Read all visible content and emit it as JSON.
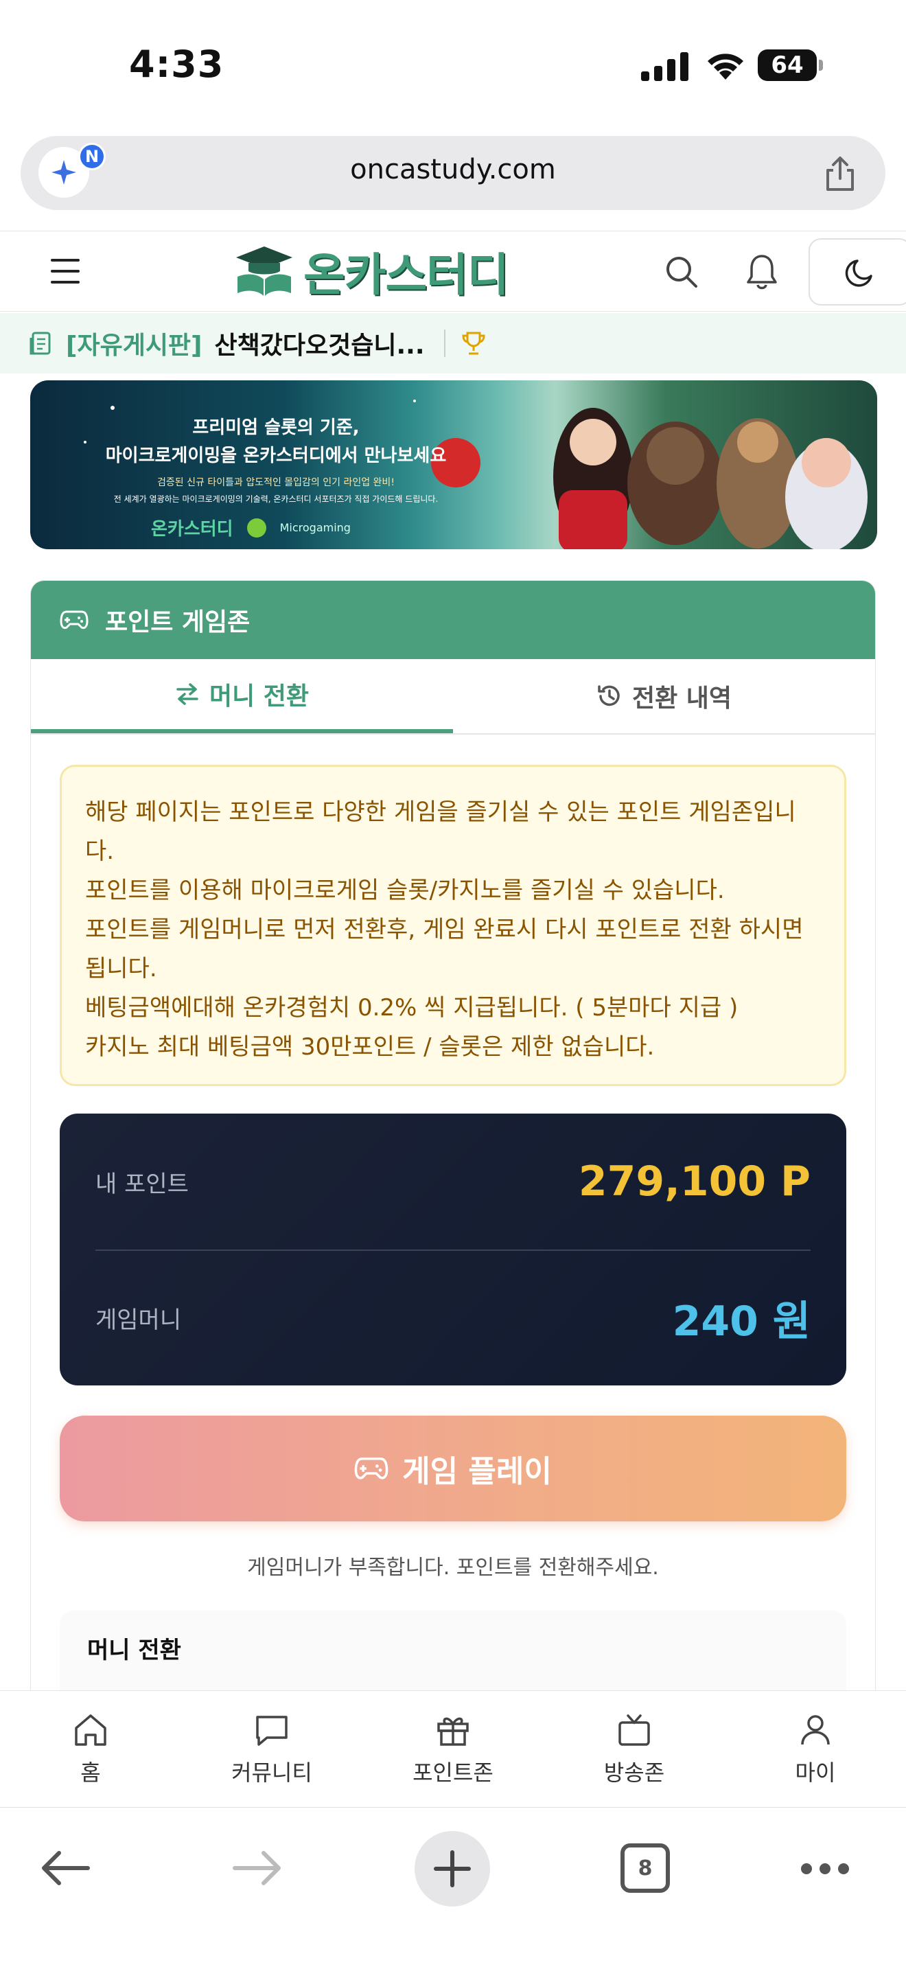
{
  "status_bar": {
    "time": "4:33",
    "battery": "64"
  },
  "browser": {
    "url": "oncastudy.com",
    "ai_badge": "N",
    "tab_count": "8"
  },
  "site": {
    "logo_text": "온카스터디"
  },
  "notice": {
    "board": "[자유게시판]",
    "title": "산책갔다오것습니..."
  },
  "banner": {
    "line1": "프리미엄 슬롯의 기준,",
    "line2": "마이크로게이밍을 온카스터디에서 만나보세요",
    "line3": "검증된 신규 타이틀과 압도적인 몰입감의 인기 라인업 완비!",
    "line4": "전 세계가 열광하는 마이크로게이밍의 기술력, 온카스터디 서포터즈가 직접 가이드해 드립니다.",
    "brand1": "온카스터디",
    "brand2": "Microgaming"
  },
  "card": {
    "title": "포인트 게임존",
    "tabs": [
      "머니 전환",
      "전환 내역"
    ],
    "info_lines": [
      "해당 페이지는 포인트로 다양한 게임을 즐기실 수 있는 포인트 게임존입니",
      "다.",
      "포인트를 이용해 마이크로게임 슬롯/카지노를 즐기실 수 있습니다.",
      "포인트를 게임머니로 먼저 전환후, 게임 완료시 다시 포인트로 전환 하시면",
      "됩니다.",
      "베팅금액에대해 온카경험치 0.2% 씩 지급됩니다. ( 5분마다 지급 )",
      "카지노 최대 베팅금액 30만포인트 / 슬롯은 제한 없습니다."
    ],
    "wallet": {
      "points_label": "내 포인트",
      "points_value": "279,100 P",
      "money_label": "게임머니",
      "money_value": "240 원"
    },
    "play_button": "게임 플레이",
    "warning": "게임머니가 부족합니다. 포인트를 전환해주세요.",
    "exchange_title": "머니 전환"
  },
  "bottom_nav": [
    "홈",
    "커뮤니티",
    "포인트존",
    "방송존",
    "마이"
  ],
  "colors": {
    "brand_green": "#4b9f7c",
    "point_yellow": "#f4c237",
    "money_blue": "#4ec1ea",
    "info_text": "#8a5300"
  }
}
